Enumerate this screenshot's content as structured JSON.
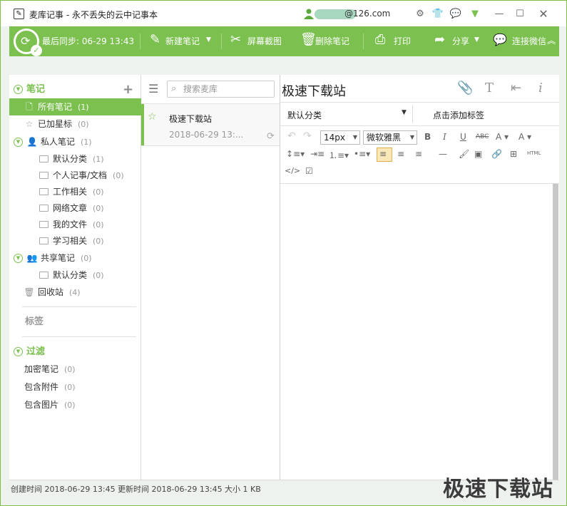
{
  "app": {
    "title": "麦库记事 - 永不丢失的云中记事本",
    "user_email": "@126.com",
    "colors": {
      "accent": "#7cc050"
    }
  },
  "toolbar": {
    "sync_label": "最后同步: 06-29 13:43",
    "new_note": "新建笔记",
    "screenshot": "屏幕截图",
    "delete_note": "删除笔记",
    "print": "打印",
    "share": "分享",
    "wechat": "连接微信"
  },
  "sidebar": {
    "notes_header": "笔记",
    "all_notes": {
      "label": "所有笔记",
      "count": "(1)"
    },
    "starred": {
      "label": "已加星标",
      "count": "(0)"
    },
    "private": {
      "label": "私人笔记",
      "count": "(1)"
    },
    "private_folders": [
      {
        "label": "默认分类",
        "count": "(1)"
      },
      {
        "label": "个人记事/文档",
        "count": "(0)"
      },
      {
        "label": "工作相关",
        "count": "(0)"
      },
      {
        "label": "网络文章",
        "count": "(0)"
      },
      {
        "label": "我的文件",
        "count": "(0)"
      },
      {
        "label": "学习相关",
        "count": "(0)"
      }
    ],
    "shared": {
      "label": "共享笔记",
      "count": "(0)"
    },
    "shared_folders": [
      {
        "label": "默认分类",
        "count": "(0)"
      }
    ],
    "trash": {
      "label": "回收站",
      "count": "(4)"
    },
    "tags_header": "标签",
    "filter_header": "过滤",
    "filters": [
      {
        "label": "加密笔记",
        "count": "(0)"
      },
      {
        "label": "包含附件",
        "count": "(0)"
      },
      {
        "label": "包含图片",
        "count": "(0)"
      }
    ]
  },
  "notelist": {
    "search_placeholder": "搜索麦库",
    "notes": [
      {
        "title": "极速下载站",
        "date": "2018-06-29 13:..."
      }
    ]
  },
  "editor": {
    "title": "极速下载站",
    "category": "默认分类",
    "add_tag": "点击添加标签",
    "font_size": "14px",
    "font_family": "微软雅黑"
  },
  "status": {
    "created": "创建时间 2018-06-29 13:45",
    "updated": "更新时间 2018-06-29 13:45",
    "size": "大小 1 KB"
  },
  "watermark": "极速下载站"
}
